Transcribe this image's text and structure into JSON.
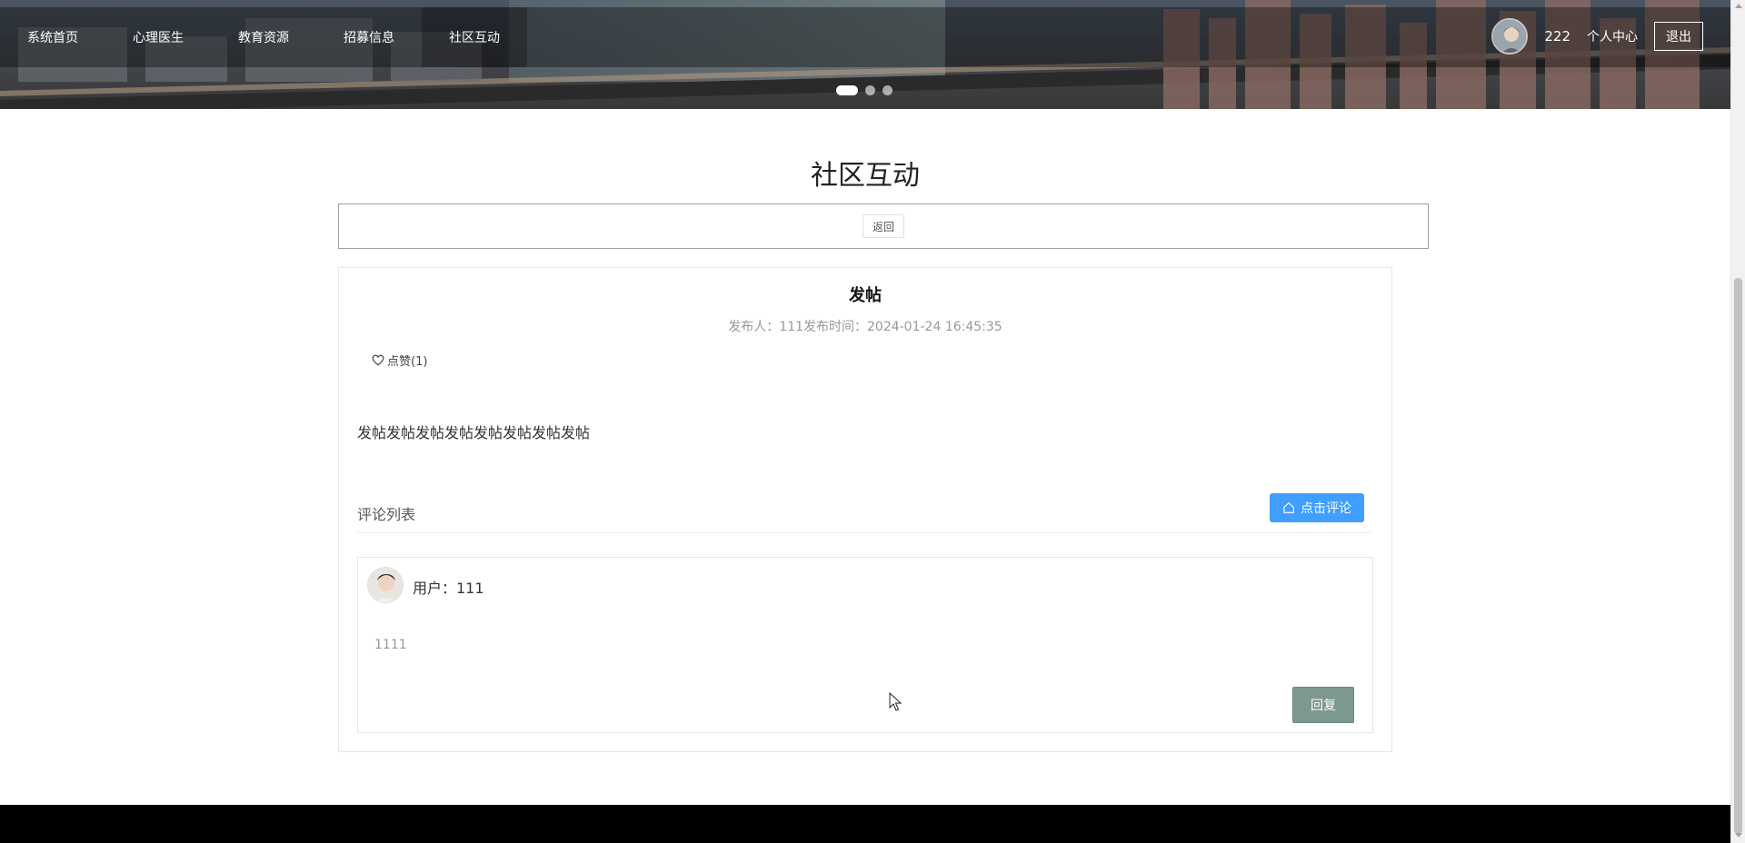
{
  "nav": {
    "items": [
      "系统首页",
      "心理医生",
      "教育资源",
      "招募信息",
      "社区互动"
    ],
    "active_index": 4
  },
  "user": {
    "name": "222",
    "center_label": "个人中心",
    "logout_label": "退出"
  },
  "carousel": {
    "slide_count": 3,
    "active_slide": 1
  },
  "page": {
    "title": "社区互动"
  },
  "back": {
    "label": "返回"
  },
  "post": {
    "title": "发帖",
    "meta": "发布人：111发布时间：2024-01-24 16:45:35",
    "like_label": "点赞(1)",
    "content": "发帖发帖发帖发帖发帖发帖发帖发帖"
  },
  "comments": {
    "header_label": "评论列表",
    "add_button_label": "点击评论",
    "items": [
      {
        "user": "用户：111",
        "text": "1111",
        "reply_label": "回复"
      }
    ]
  },
  "colors": {
    "primary": "#409eff",
    "reply": "#7d998e",
    "footer": "#000000"
  }
}
